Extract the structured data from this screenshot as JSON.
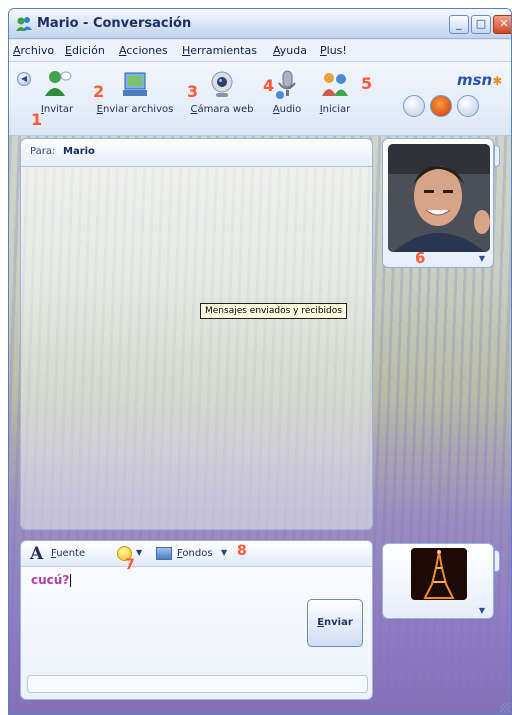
{
  "window": {
    "title": "Mario - Conversación",
    "controls": {
      "minimize": "_",
      "maximize": "□",
      "close": "✕"
    }
  },
  "menu": [
    "Archivo",
    "Edición",
    "Acciones",
    "Herramientas",
    "Ayuda",
    "Plus!"
  ],
  "toolbar": {
    "items": [
      {
        "label": "Invitar",
        "icon": "invite-contact-icon",
        "marker": "1"
      },
      {
        "label": "Enviar archivos",
        "icon": "send-files-icon",
        "marker": "2"
      },
      {
        "label": "Cámara web",
        "icon": "webcam-icon",
        "marker": "3"
      },
      {
        "label": "Audio",
        "icon": "microphone-icon",
        "marker": "4"
      },
      {
        "label": "Iniciar",
        "icon": "activities-icon",
        "marker": "5"
      }
    ],
    "logo": "msn"
  },
  "conversation": {
    "to_label": "Para:",
    "to_name": "Mario",
    "tooltip": "Mensajes enviados y recibidos"
  },
  "contact_avatar": {
    "marker": "6",
    "chevron": "▼"
  },
  "compose": {
    "font_label": "Fuente",
    "emoticon_marker": "7",
    "backgrounds_label": "Fondos",
    "backgrounds_marker": "8",
    "typed_text": "cucú?",
    "send_label": "Enviar"
  },
  "own_avatar": {
    "chevron": "▼"
  },
  "colors": {
    "accent": "#2a55b4",
    "marker": "#ff5a3a",
    "typed_text": "#b23fa8"
  }
}
